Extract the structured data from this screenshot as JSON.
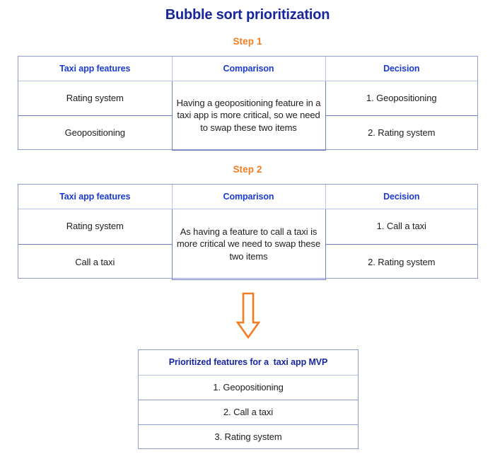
{
  "title": "Bubble sort prioritization",
  "colors": {
    "title_blue": "#17269e",
    "header_blue": "#1b3ad4",
    "accent_orange": "#f47b20",
    "border_blue": "#6d7fbd",
    "border_light": "#b9c3e8",
    "body_text": "#1d1d1d",
    "background": "#ffffff"
  },
  "steps": [
    {
      "label": "Step 1",
      "columns": [
        "Taxi app features",
        "Comparison",
        "Decision"
      ],
      "features": [
        "Rating system",
        "Geopositioning"
      ],
      "comparison": "Having a geopositioning feature in a taxi app is more critical, so we need to swap these two items",
      "decisions": [
        "1. Geopositioning",
        "2. Rating system"
      ]
    },
    {
      "label": "Step 2",
      "columns": [
        "Taxi app features",
        "Comparison",
        "Decision"
      ],
      "features": [
        "Rating system",
        "Call a taxi"
      ],
      "comparison": "As having a feature to call a taxi is more critical we need to swap these two items",
      "decisions": [
        "1. Call a taxi",
        "2. Rating system"
      ]
    }
  ],
  "arrow": {
    "icon": "arrow-down-icon",
    "direction": "down",
    "color": "#f47b20"
  },
  "result": {
    "header": "Prioritized features for a  taxi app MVP",
    "items": [
      "1. Geopositioning",
      "2. Call a taxi",
      "3. Rating system"
    ]
  }
}
